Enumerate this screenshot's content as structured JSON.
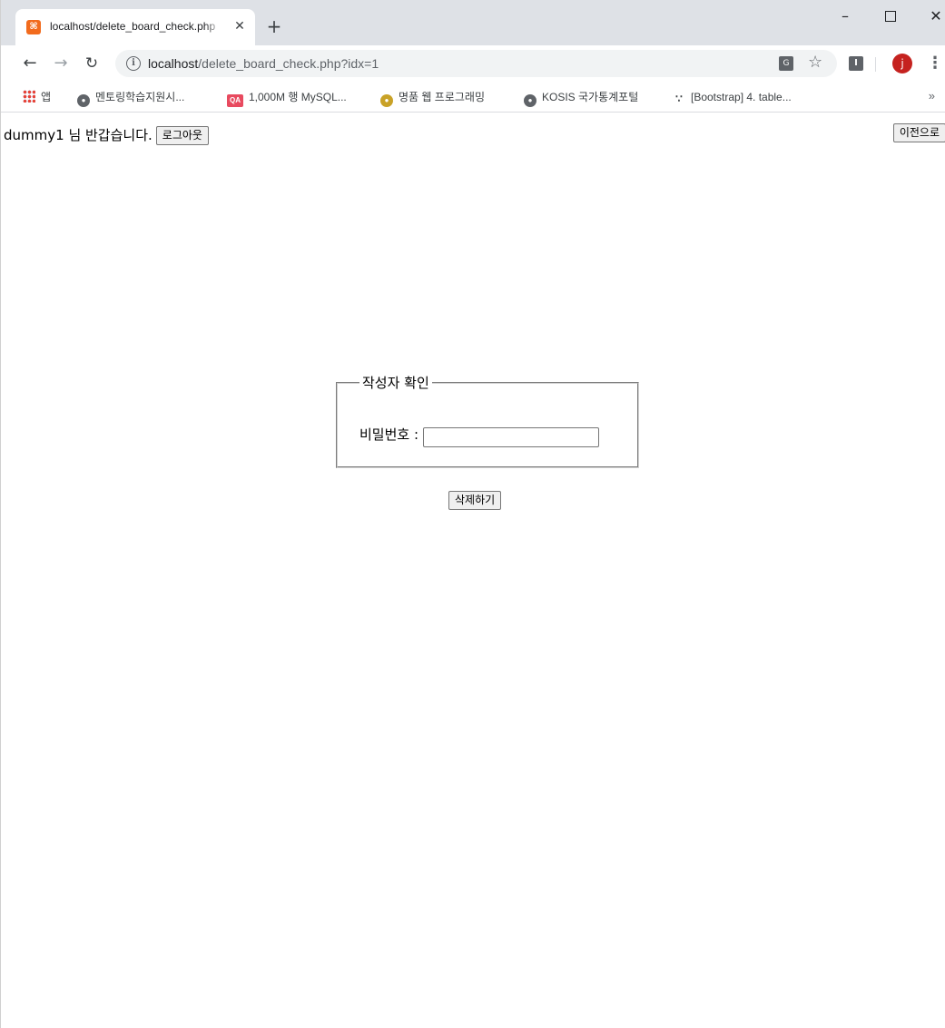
{
  "browser": {
    "tab_title": "localhost/delete_board_check.php",
    "tab_favicon": "xampp-icon",
    "new_tab": "+",
    "url_host": "localhost",
    "url_path": "/delete_board_check.php?idx=1",
    "profile_initial": "j",
    "ext_initial": "I",
    "bookmarks": [
      {
        "label": "앱",
        "icon": "apps-icon"
      },
      {
        "label": "멘토링학습지원시...",
        "icon": "globe-icon"
      },
      {
        "label": "1,000M 행 MySQL...",
        "icon": "qa-icon"
      },
      {
        "label": "명품 웹 프로그래밍",
        "icon": "book-icon"
      },
      {
        "label": "KOSIS 국가통계포털",
        "icon": "globe-icon"
      },
      {
        "label": "[Bootstrap] 4. table...",
        "icon": "bootstrap-icon"
      }
    ],
    "bookmarks_more": "»"
  },
  "page": {
    "greeting": "dummy1 님 반갑습니다.",
    "logout_label": "로그아웃",
    "back_label": "이전으로",
    "fieldset_legend": "작성자 확인",
    "password_label": "비밀번호 :",
    "password_value": "",
    "delete_label": "삭제하기"
  }
}
